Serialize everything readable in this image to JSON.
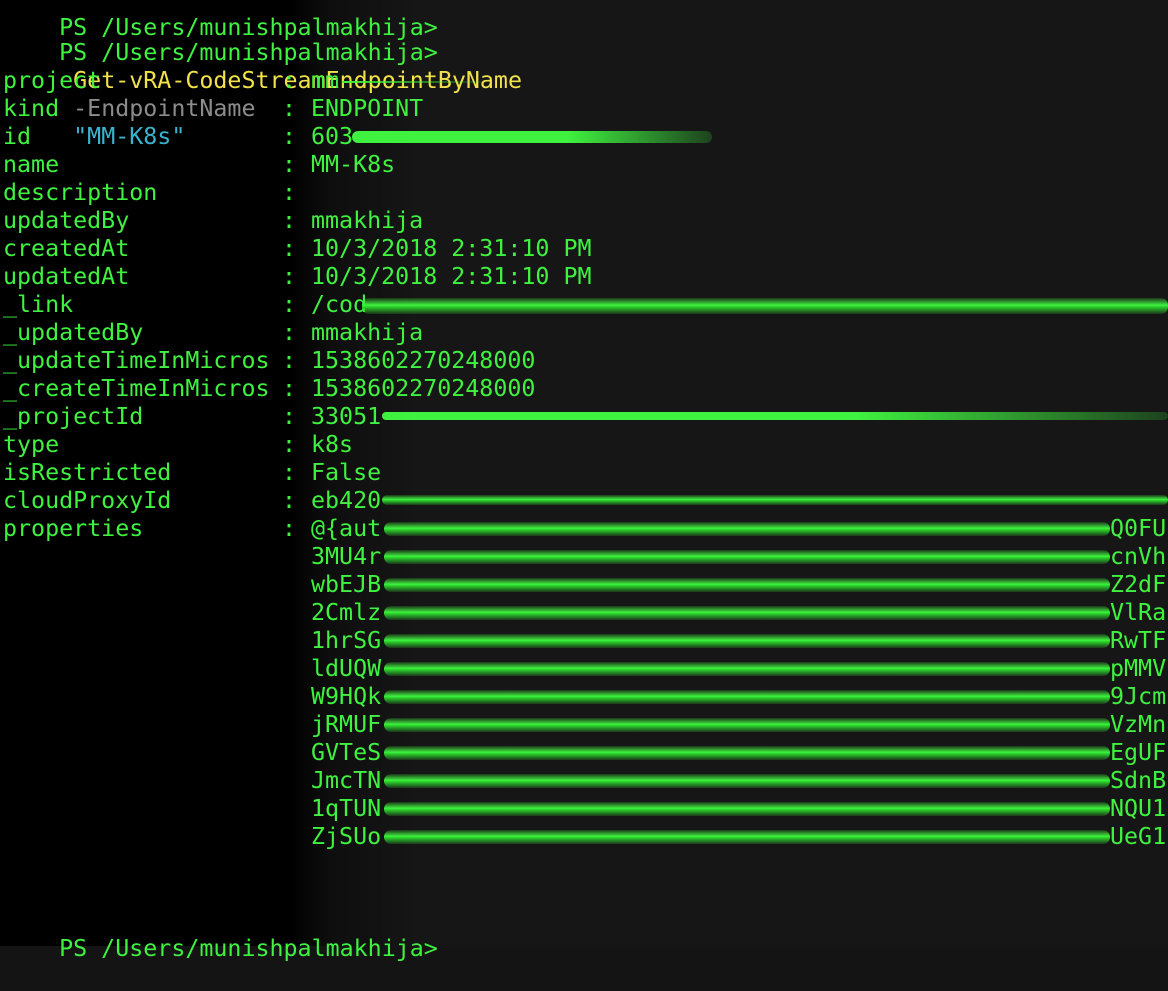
{
  "session": {
    "top_cut_text": "PS /Users/munishpalmakhija>",
    "prompt": "PS /Users/munishpalmakhija>",
    "command": "Get-vRA-CodeStreamEndpointByName",
    "param_name": "-EndpointName",
    "param_value": "\"MM-K8s\"",
    "final_prompt": "PS /Users/munishpalmakhija>"
  },
  "output": {
    "rows": [
      {
        "key": "project",
        "value": "mm"
      },
      {
        "key": "kind",
        "value": "ENDPOINT"
      },
      {
        "key": "id",
        "value": "603"
      },
      {
        "key": "name",
        "value": "MM-K8s"
      },
      {
        "key": "description",
        "value": ""
      },
      {
        "key": "updatedBy",
        "value": "mmakhija"
      },
      {
        "key": "createdAt",
        "value": "10/3/2018 2:31:10 PM"
      },
      {
        "key": "updatedAt",
        "value": "10/3/2018 2:31:10 PM"
      },
      {
        "key": "_link",
        "value": "/cod"
      },
      {
        "key": "_updatedBy",
        "value": "mmakhija"
      },
      {
        "key": "_updateTimeInMicros",
        "value": "153860227024800​0"
      },
      {
        "key": "_createTimeInMicros",
        "value": "153860227024800​0"
      },
      {
        "key": "_projectId",
        "value": "33051"
      },
      {
        "key": "type",
        "value": "k8s"
      },
      {
        "key": "isRestricted",
        "value": "False"
      },
      {
        "key": "cloudProxyId",
        "value": "eb420"
      },
      {
        "key": "properties",
        "value": "@{aut"
      }
    ],
    "separator": ":",
    "properties_lines": [
      {
        "left": "3MU4r",
        "right": "cnVh"
      },
      {
        "left": "wbEJB",
        "right": "Z2dF"
      },
      {
        "left": "2Cmlz",
        "right": "VlRa"
      },
      {
        "left": "1hrSG",
        "right": "RwTF"
      },
      {
        "left": "ldUQW",
        "right": "pMMV"
      },
      {
        "left": "W9HQk",
        "right": "9Jcm"
      },
      {
        "left": "jRMUF",
        "right": "VzMn"
      },
      {
        "left": "GVTeS",
        "right": "EgUF"
      },
      {
        "left": "JmcTN",
        "right": "SdnB"
      },
      {
        "left": "1qTUN",
        "right": "NQU1"
      },
      {
        "left": "ZjSUo",
        "right": "UeG1"
      }
    ],
    "properties_first_right": "Q0FU"
  },
  "colors": {
    "text_green": "#3ff23f",
    "command_yellow": "#f1e24a",
    "param_gray": "#8c8c8c",
    "string_cyan": "#39b4cf",
    "background": "#000000"
  }
}
